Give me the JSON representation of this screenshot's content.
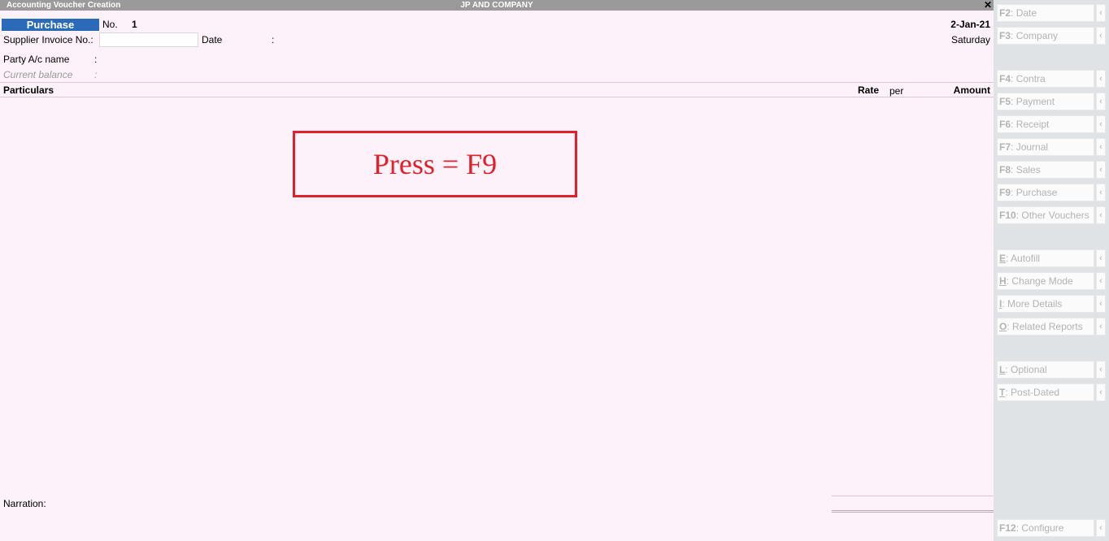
{
  "titlebar": {
    "left": "Accounting Voucher Creation",
    "center": "JP AND COMPANY",
    "close": "✕"
  },
  "voucher": {
    "type": "Purchase",
    "no_label": "No.",
    "no_value": "1",
    "date": "2-Jan-21",
    "day": "Saturday",
    "supplier_invoice_label": "Supplier Invoice No.:",
    "supplier_invoice_value": "",
    "date_label": "Date",
    "date_colon": ":",
    "party_label": "Party A/c name",
    "party_colon": ":",
    "balance_label": "Current balance",
    "balance_colon": ":",
    "narration_label": "Narration:"
  },
  "columns": {
    "particulars": "Particulars",
    "rate": "Rate",
    "per": "per",
    "amount": "Amount"
  },
  "annotation": {
    "text": "Press = F9",
    "color": "#e0202a"
  },
  "sidebar": {
    "buttons": [
      {
        "key": "F2",
        "sep": ":",
        "label": "Date",
        "underline": false
      },
      {
        "key": "F3",
        "sep": ":",
        "label": "Company",
        "underline": false
      },
      {
        "key": "F4",
        "sep": ":",
        "label": "Contra",
        "underline": false
      },
      {
        "key": "F5",
        "sep": ":",
        "label": "Payment",
        "underline": false
      },
      {
        "key": "F6",
        "sep": ":",
        "label": "Receipt",
        "underline": false
      },
      {
        "key": "F7",
        "sep": ":",
        "label": "Journal",
        "underline": false
      },
      {
        "key": "F8",
        "sep": ":",
        "label": "Sales",
        "underline": false
      },
      {
        "key": "F9",
        "sep": ":",
        "label": "Purchase",
        "underline": false
      },
      {
        "key": "F10",
        "sep": ":",
        "label": "Other Vouchers",
        "underline": false
      },
      {
        "key": "E",
        "sep": ":",
        "label": "Autofill",
        "underline": true
      },
      {
        "key": "H",
        "sep": ":",
        "label": "Change Mode",
        "underline": true
      },
      {
        "key": "I",
        "sep": ":",
        "label": "More Details",
        "underline": true
      },
      {
        "key": "O",
        "sep": ":",
        "label": "Related Reports",
        "underline": true
      },
      {
        "key": "L",
        "sep": ":",
        "label": "Optional",
        "underline": true
      },
      {
        "key": "T",
        "sep": ":",
        "label": "Post-Dated",
        "underline": true
      },
      {
        "key": "F12",
        "sep": ":",
        "label": "Configure",
        "underline": false
      }
    ],
    "chevron": "‹"
  },
  "colors": {
    "vtype_bg": "#2a6ab8",
    "body_bg": "#fdf1fa",
    "sidebar_bg": "#dfe3e6"
  }
}
